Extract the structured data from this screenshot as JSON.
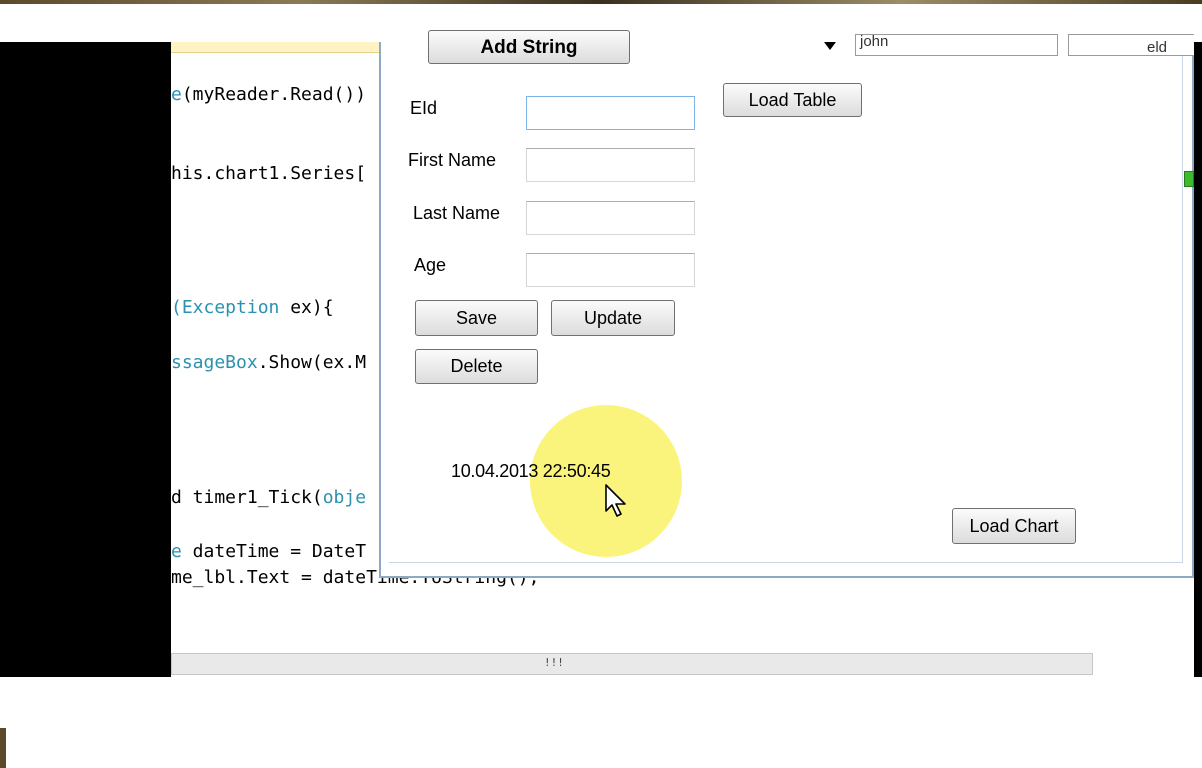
{
  "editor": {
    "code_lines": [
      {
        "pre": "",
        "kw": "e",
        "post": "(myReader.Read())"
      },
      {
        "pre": "",
        "kw": "",
        "post": "his.chart1.Series["
      },
      {
        "pre": "",
        "kw": "(Exception",
        "post": " ex){"
      },
      {
        "pre": "",
        "kw": "ssageBox",
        "post": ".Show(ex.M"
      },
      {
        "pre": "d timer1_Tick(",
        "kw": "obje",
        "post": ""
      },
      {
        "pre": "",
        "kw": "e",
        "post": " dateTime = DateT"
      },
      {
        "pre": "me_lbl.Text = dateTime.ToString();",
        "kw": "",
        "post": ""
      }
    ],
    "scrollbar_grip": "!!!"
  },
  "form": {
    "add_string_label": "Add String",
    "combo_value": "john",
    "eid_box_value": "eld",
    "load_table_label": "Load Table",
    "fields": {
      "eid_label": "EId",
      "first_name_label": "First Name",
      "last_name_label": "Last Name",
      "age_label": "Age"
    },
    "save_label": "Save",
    "update_label": "Update",
    "delete_label": "Delete",
    "datetime_text": "10.04.2013 22:50:45",
    "load_chart_label": "Load Chart"
  },
  "colors": {
    "keyword": "#2b91af",
    "highlight": "#f7ee4a",
    "window_border": "#8fa9c4"
  }
}
